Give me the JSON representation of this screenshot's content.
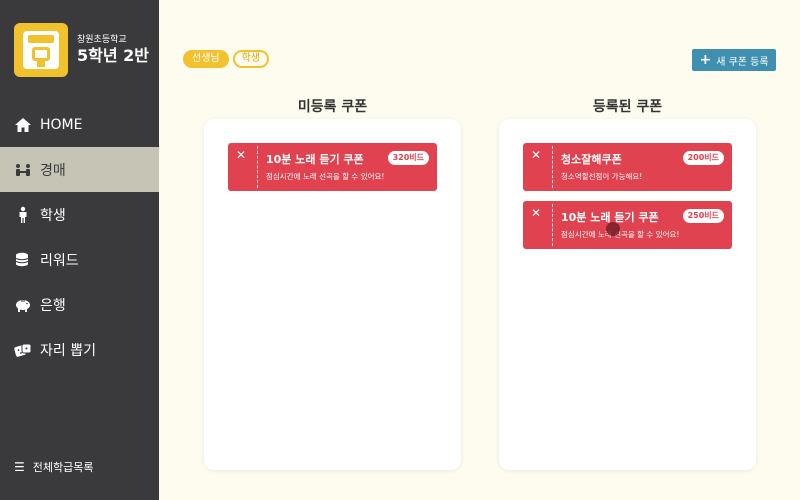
{
  "sidebar": {
    "school": "창원초등학교",
    "class_name": "5학년 2반",
    "items": [
      {
        "label": "HOME",
        "icon": "home-icon"
      },
      {
        "label": "경매",
        "icon": "auction-icon"
      },
      {
        "label": "학생",
        "icon": "student-icon"
      },
      {
        "label": "리워드",
        "icon": "coins-icon"
      },
      {
        "label": "은행",
        "icon": "piggy-bank-icon"
      },
      {
        "label": "자리 뽑기",
        "icon": "dice-icon"
      }
    ],
    "active_index": 1,
    "class_list_label": "전체학급목록"
  },
  "toggle": {
    "teacher": "선생님",
    "student": "학생"
  },
  "add_button": "새 쿠폰 등록",
  "unregistered": {
    "title": "미등록 쿠폰",
    "coupons": [
      {
        "name": "10분 노래 듣기 쿠폰",
        "desc": "점심시간에 노래 선곡을 할 수 있어요!",
        "price": "320비드"
      }
    ]
  },
  "registered": {
    "title": "등록된 쿠폰",
    "coupons": [
      {
        "name": "청소잘해쿠폰",
        "desc": "청소역할선점이 가능해요!",
        "price": "200비드"
      },
      {
        "name": "10분 노래 듣기 쿠폰",
        "desc": "점심시간에 노래 선곡을 할 수 있어요!",
        "price": "250비드"
      }
    ]
  },
  "colors": {
    "sidebar": "#3a3a3c",
    "accent_yellow": "#f2c12e",
    "coupon_red": "#e0424f",
    "button_blue": "#3f8fb0"
  }
}
